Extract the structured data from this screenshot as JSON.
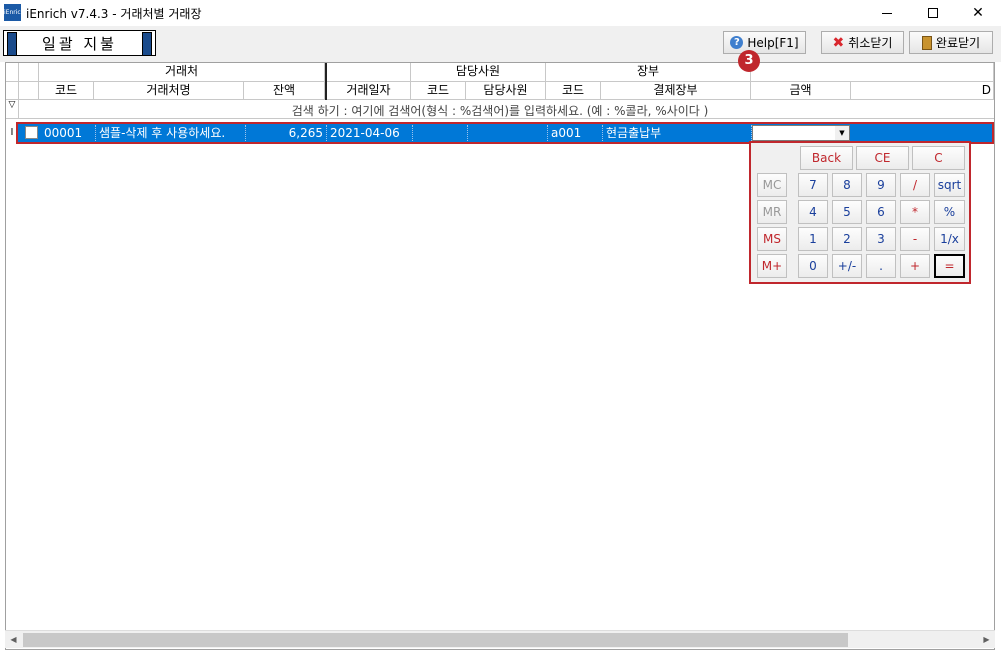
{
  "window": {
    "title": "iEnrich v7.4.3 - 거래처별 거래장",
    "app_icon_text": "iEnrich"
  },
  "toolbar": {
    "mode_label": "일괄 지불",
    "help_label": "Help[F1]",
    "cancel_label": "취소닫기",
    "done_label": "완료닫기"
  },
  "grid": {
    "band_headers": {
      "client": "거래처",
      "staff": "담당사원",
      "ledger": "장부"
    },
    "columns": {
      "code": "코드",
      "client_name": "거래처명",
      "balance": "잔액",
      "trade_date": "거래일자",
      "staff_code": "코드",
      "staff_name": "담당사원",
      "ledger_code": "코드",
      "payment_ledger": "결제장부",
      "amount": "금액",
      "extra": "D"
    },
    "filter_hint": "검색 하기 : 여기에 검색어(형식 : %검색어)를 입력하세요. (예 : %콜라, %사이다 )",
    "rows": [
      {
        "code": "00001",
        "client_name": "샘플-삭제 후 사용하세요.",
        "balance": "6,265",
        "trade_date": "2021-04-06",
        "staff_code": "",
        "staff_name": "",
        "ledger_code": "a001",
        "payment_ledger": "현금출납부",
        "amount": ""
      }
    ]
  },
  "annotation_badge": "3",
  "calculator": {
    "row1": [
      "Back",
      "CE",
      "C"
    ],
    "memory": [
      "MC",
      "MR",
      "MS",
      "M+"
    ],
    "row2": [
      "7",
      "8",
      "9",
      "/",
      "sqrt"
    ],
    "row3": [
      "4",
      "5",
      "6",
      "*",
      "%"
    ],
    "row4": [
      "1",
      "2",
      "3",
      "-",
      "1/x"
    ],
    "row5": [
      "0",
      "+/-",
      ".",
      "+",
      "="
    ]
  }
}
